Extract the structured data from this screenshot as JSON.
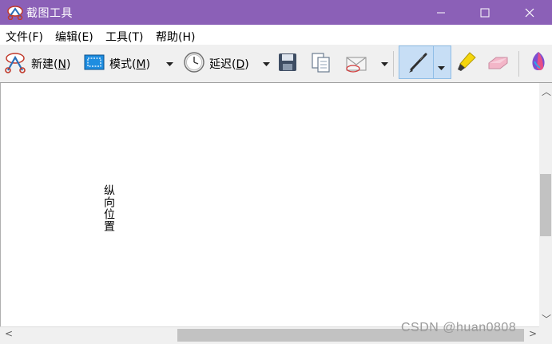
{
  "window": {
    "title": "截图工具",
    "controls": {
      "minimize": "─",
      "maximize": "☐",
      "close": "✕"
    }
  },
  "menu": {
    "items": [
      "文件(F)",
      "编辑(E)",
      "工具(T)",
      "帮助(H)"
    ]
  },
  "toolbar": {
    "new_label": "新建(",
    "new_key": "N",
    "new_close": ")",
    "mode_label": "模式(",
    "mode_key": "M",
    "mode_close": ")",
    "delay_label": "延迟(",
    "delay_key": "D",
    "delay_close": ")",
    "dropdown_glyph": "▼",
    "icons": [
      "scissors-icon",
      "mode-rect-icon",
      "clock-icon",
      "save-icon",
      "copy-icon",
      "email-icon",
      "pen-icon",
      "highlighter-icon",
      "eraser-icon",
      "paint3d-icon"
    ],
    "pen_selected": true
  },
  "canvas": {
    "vertical_text": "纵向位置"
  },
  "scrollbars": {
    "left_arrow": "<",
    "right_arrow": ">",
    "up_arrow": "︿",
    "down_arrow": "﹀"
  },
  "watermark": "CSDN @huan0808",
  "colors": {
    "titlebar": "#8b60b7",
    "toolbar_bg": "#f0f0f0",
    "pen_selected_bg": "#c7def5"
  }
}
